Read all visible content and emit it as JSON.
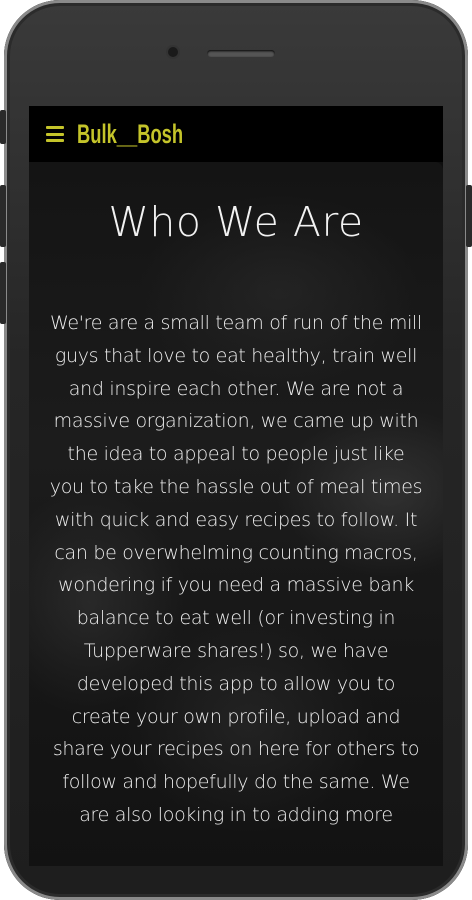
{
  "navbar": {
    "menu_icon": "hamburger-menu-icon",
    "brand": "Bulk__Bosh",
    "brand_color": "#c4c42a"
  },
  "hero": {
    "title": "Who We Are",
    "body": "We're are a small team of run of the mill guys that love to eat healthy, train well and inspire each other. We are not a massive organization, we came up with the idea to appeal to people just like you to take the hassle out of meal times with quick and easy recipes to follow. It can be overwhelming counting macros, wondering if you need a massive bank balance to eat well (or investing in Tupperware shares!) so, we have developed this app to allow you to create your own profile, upload and share your recipes on here for others to follow and hopefully do the same. We are also looking in to adding more"
  }
}
